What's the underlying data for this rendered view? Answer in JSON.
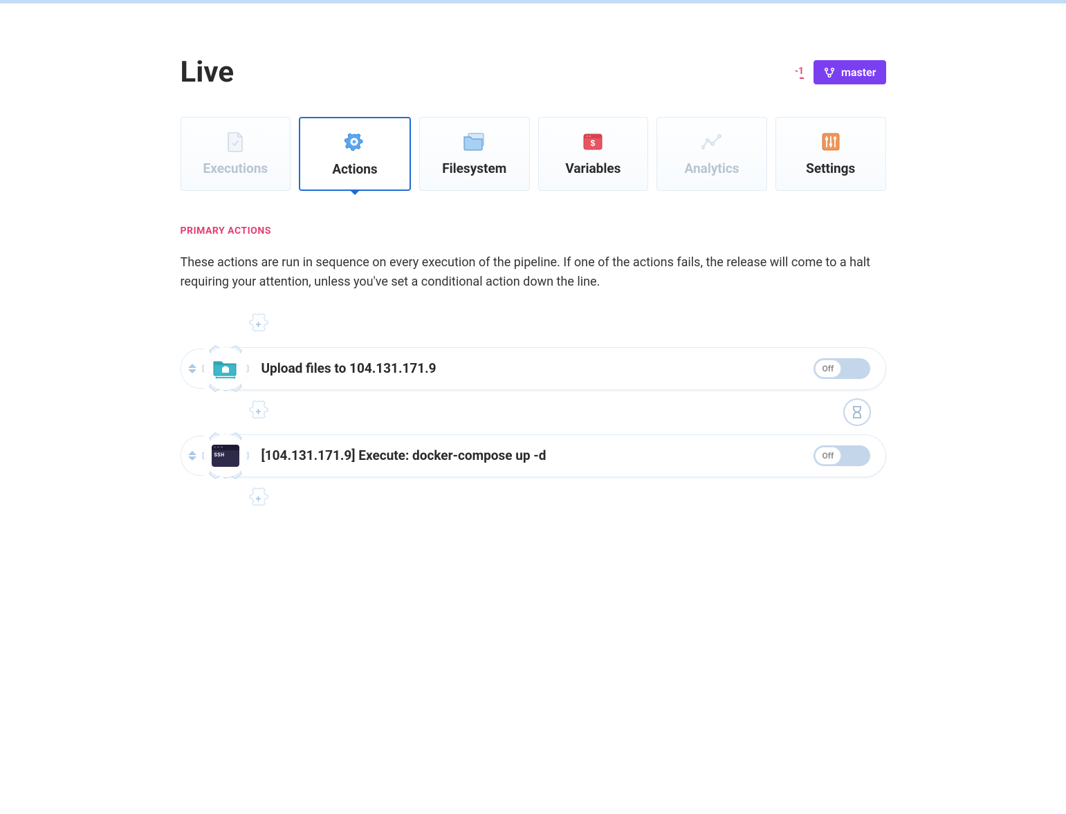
{
  "header": {
    "title": "Live",
    "diff_count": "-1",
    "branch": "master"
  },
  "tabs": [
    {
      "id": "executions",
      "label": "Executions",
      "active": false,
      "disabled": true
    },
    {
      "id": "actions",
      "label": "Actions",
      "active": true,
      "disabled": false
    },
    {
      "id": "filesystem",
      "label": "Filesystem",
      "active": false,
      "disabled": false
    },
    {
      "id": "variables",
      "label": "Variables",
      "active": false,
      "disabled": false
    },
    {
      "id": "analytics",
      "label": "Analytics",
      "active": false,
      "disabled": true
    },
    {
      "id": "settings",
      "label": "Settings",
      "active": false,
      "disabled": false
    }
  ],
  "section": {
    "heading": "PRIMARY ACTIONS",
    "description": "These actions are run in sequence on every execution of the pipeline. If one of the actions fails, the release will come to a halt requiring your attention, unless you've set a conditional action down the line."
  },
  "actions": [
    {
      "id": "upload",
      "title": "Upload files to 104.131.171.9",
      "toggle": "Off",
      "icon": "ftp"
    },
    {
      "id": "ssh",
      "title": "[104.131.171.9] Execute: docker-compose up -d",
      "toggle": "Off",
      "icon": "ssh"
    }
  ],
  "colors": {
    "accent_purple": "#7b3ff2",
    "accent_pink": "#e43d6f",
    "accent_blue": "#1e6dd6",
    "soft_blue": "#c3d6ea"
  }
}
